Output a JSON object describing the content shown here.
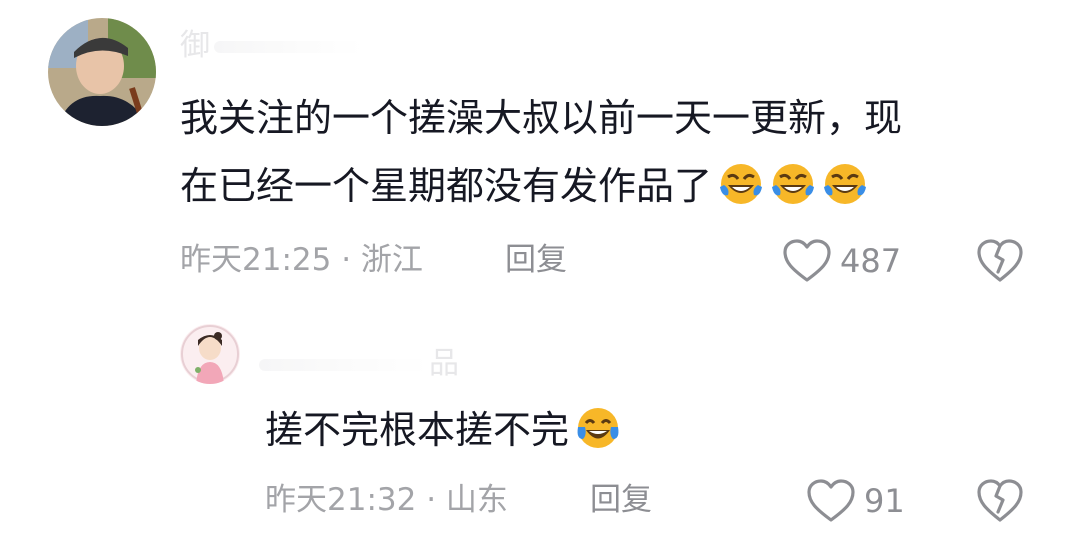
{
  "comments": [
    {
      "username": "御",
      "text_line1": "我关注的一个搓澡大叔以前一天一更新，现",
      "text_line2": "在已经一个星期都没有发作品了",
      "emoji_icon": "rolling-laughing-emoji",
      "emoji_count": 3,
      "time": "昨天21:25 · 浙江",
      "reply_label": "回复",
      "likes": "487"
    },
    {
      "username": "品",
      "text_line1": "搓不完根本搓不完",
      "emoji_icon": "tears-of-joy-emoji",
      "emoji_count": 1,
      "time": "昨天21:32 · 山东",
      "reply_label": "回复",
      "likes": "91"
    }
  ],
  "colors": {
    "text": "#161823",
    "meta": "#a3a4a8",
    "action": "#8d8e93",
    "emoji_face": "#f7b728",
    "emoji_tear": "#3a8ee6"
  }
}
